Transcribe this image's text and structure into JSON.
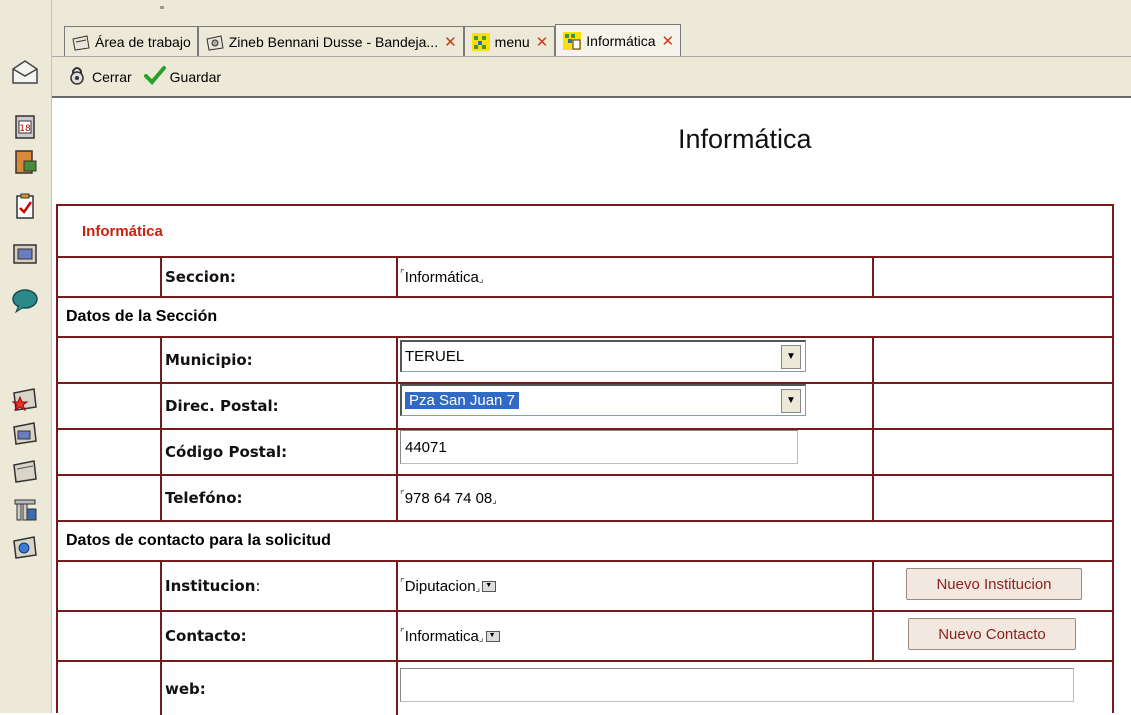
{
  "rail": {
    "icons": [
      "envelope-icon",
      "calendar-icon",
      "book-exit-icon",
      "clipboard-check-icon",
      "cabinet-icon",
      "chat-bubble-icon",
      "favorites-tray-icon",
      "inbox-tray-icon",
      "empty-tray-icon",
      "file-cabinet-icon",
      "web-tray-icon"
    ]
  },
  "tabs": [
    {
      "label": "Área de trabajo",
      "icon": "workspace-icon",
      "closable": false
    },
    {
      "label": "Zineb Bennani Dusse - Bandeja...",
      "icon": "tray-icon",
      "closable": true
    },
    {
      "label": "menu",
      "icon": "grid-icon",
      "closable": true
    },
    {
      "label": "Informática",
      "icon": "grid-doc-icon",
      "closable": true,
      "active": true
    }
  ],
  "toolbar": {
    "close_label": "Cerrar",
    "save_label": "Guardar"
  },
  "page": {
    "title": "Informática"
  },
  "form": {
    "header": "Informática",
    "seccion_label": "Seccion:",
    "seccion_value": "Informática",
    "section1": "Datos de la Sección",
    "municipio_label": "Municipio:",
    "municipio_value": "TERUEL",
    "direc_label": "Direc. Postal:",
    "direc_value": "Pza San Juan 7",
    "codigo_label": "Código Postal:",
    "codigo_value": "44071",
    "telefono_label": "Telefóno:",
    "telefono_value": "978 64 74 08",
    "section2": "Datos de contacto para la solicitud",
    "institucion_label": "Institucion",
    "institucion_colon": ":",
    "institucion_value": "Diputacion",
    "nuevo_institucion": "Nuevo Institucion",
    "contacto_label": "Contacto:",
    "contacto_value": "Informatica",
    "nuevo_contacto": "Nuevo Contacto",
    "web_label": "web:",
    "web_value": ""
  },
  "colors": {
    "grid_border": "#7a1a1a",
    "header_red": "#c8210e",
    "chrome_bg": "#ece9d8",
    "selection": "#316ac5"
  }
}
